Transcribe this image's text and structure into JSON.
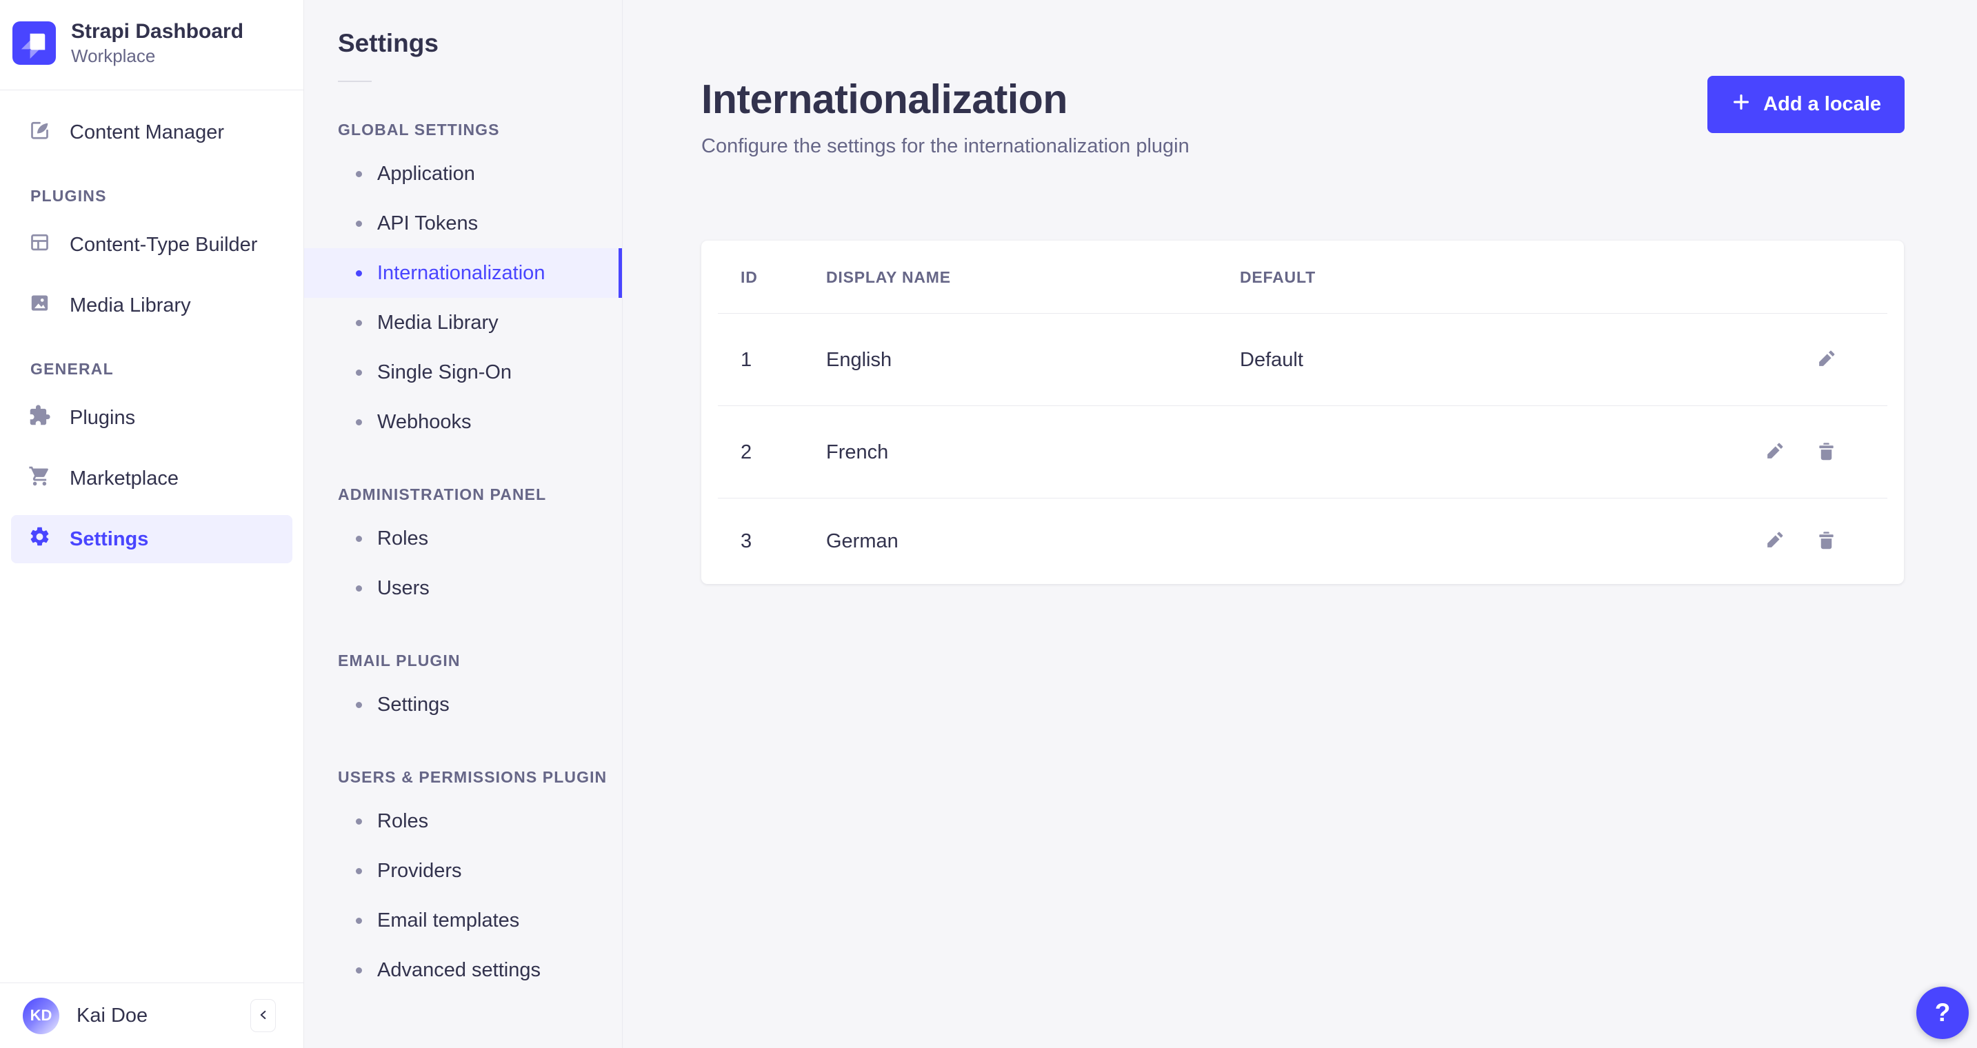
{
  "brand": {
    "name": "Strapi Dashboard",
    "workplace": "Workplace"
  },
  "sidebar": {
    "content_manager": "Content Manager",
    "sections": [
      {
        "label": "PLUGINS",
        "items": [
          {
            "label": "Content-Type Builder"
          },
          {
            "label": "Media Library"
          }
        ]
      },
      {
        "label": "GENERAL",
        "items": [
          {
            "label": "Plugins"
          },
          {
            "label": "Marketplace"
          },
          {
            "label": "Settings"
          }
        ]
      }
    ],
    "user": {
      "name": "Kai Doe",
      "initials": "KD"
    }
  },
  "subnav": {
    "title": "Settings",
    "sections": [
      {
        "label": "GLOBAL SETTINGS",
        "items": [
          {
            "label": "Application"
          },
          {
            "label": "API Tokens"
          },
          {
            "label": "Internationalization"
          },
          {
            "label": "Media Library"
          },
          {
            "label": "Single Sign-On"
          },
          {
            "label": "Webhooks"
          }
        ]
      },
      {
        "label": "ADMINISTRATION PANEL",
        "items": [
          {
            "label": "Roles"
          },
          {
            "label": "Users"
          }
        ]
      },
      {
        "label": "EMAIL PLUGIN",
        "items": [
          {
            "label": "Settings"
          }
        ]
      },
      {
        "label": "USERS & PERMISSIONS PLUGIN",
        "items": [
          {
            "label": "Roles"
          },
          {
            "label": "Providers"
          },
          {
            "label": "Email templates"
          },
          {
            "label": "Advanced settings"
          }
        ]
      }
    ]
  },
  "main": {
    "title": "Internationalization",
    "subtitle": "Configure the settings for the internationalization plugin",
    "add_button_label": "Add a locale",
    "table": {
      "headers": {
        "id": "ID",
        "display_name": "DISPLAY NAME",
        "default": "DEFAULT"
      },
      "rows": [
        {
          "id": "1",
          "display_name": "English",
          "default": "Default"
        },
        {
          "id": "2",
          "display_name": "French",
          "default": ""
        },
        {
          "id": "3",
          "display_name": "German",
          "default": ""
        }
      ]
    }
  },
  "help": {
    "label": "?"
  },
  "colors": {
    "primary": "#4945FF",
    "primary_bg": "#F0F0FF",
    "text": "#32324D",
    "muted": "#666687",
    "icon": "#8E8EA9",
    "border": "#EAEAEF",
    "panel_bg": "#F6F6F9"
  }
}
